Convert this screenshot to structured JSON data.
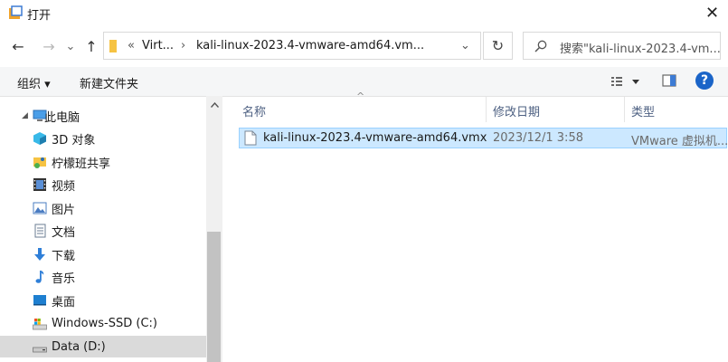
{
  "window": {
    "title": "打开",
    "close_glyph": "✕"
  },
  "nav": {
    "back_glyph": "←",
    "forward_glyph": "→",
    "recent_glyph": "⌄",
    "up_glyph": "↑",
    "breadcrumb": {
      "overflow": "«",
      "crumbs": [
        "Virt...",
        "kali-linux-2023.4-vmware-amd64.vm..."
      ],
      "sep": "›",
      "dropdown_glyph": "⌄"
    },
    "refresh_glyph": "↻",
    "search_placeholder": "搜索\"kali-linux-2023.4-vm..."
  },
  "toolbar": {
    "organize_label": "组织 ▾",
    "new_folder_label": "新建文件夹",
    "help_glyph": "?"
  },
  "sidebar": {
    "items": [
      {
        "label": "此电脑",
        "icon": "computer-icon"
      },
      {
        "label": "3D 对象",
        "icon": "3d-objects-icon"
      },
      {
        "label": "柠檬班共享",
        "icon": "shared-folder-icon"
      },
      {
        "label": "视频",
        "icon": "video-icon"
      },
      {
        "label": "图片",
        "icon": "pictures-icon"
      },
      {
        "label": "文档",
        "icon": "documents-icon"
      },
      {
        "label": "下载",
        "icon": "download-icon"
      },
      {
        "label": "音乐",
        "icon": "music-icon"
      },
      {
        "label": "桌面",
        "icon": "desktop-icon"
      },
      {
        "label": "Windows-SSD (C:)",
        "icon": "system-drive-icon"
      },
      {
        "label": "Data (D:)",
        "icon": "drive-icon"
      }
    ],
    "selected_index": 10
  },
  "file_list": {
    "columns": [
      "名称",
      "修改日期",
      "类型"
    ],
    "sort_glyph": "^",
    "rows": [
      {
        "name": "kali-linux-2023.4-vmware-amd64.vmx",
        "modified": "2023/12/1 3:58",
        "type": "VMware 虚拟机..."
      }
    ]
  },
  "colors": {
    "selection_bg": "#cce8ff",
    "selection_border": "#99d1ff",
    "help_blue": "#1a64c8",
    "header_text": "#4d6082"
  }
}
